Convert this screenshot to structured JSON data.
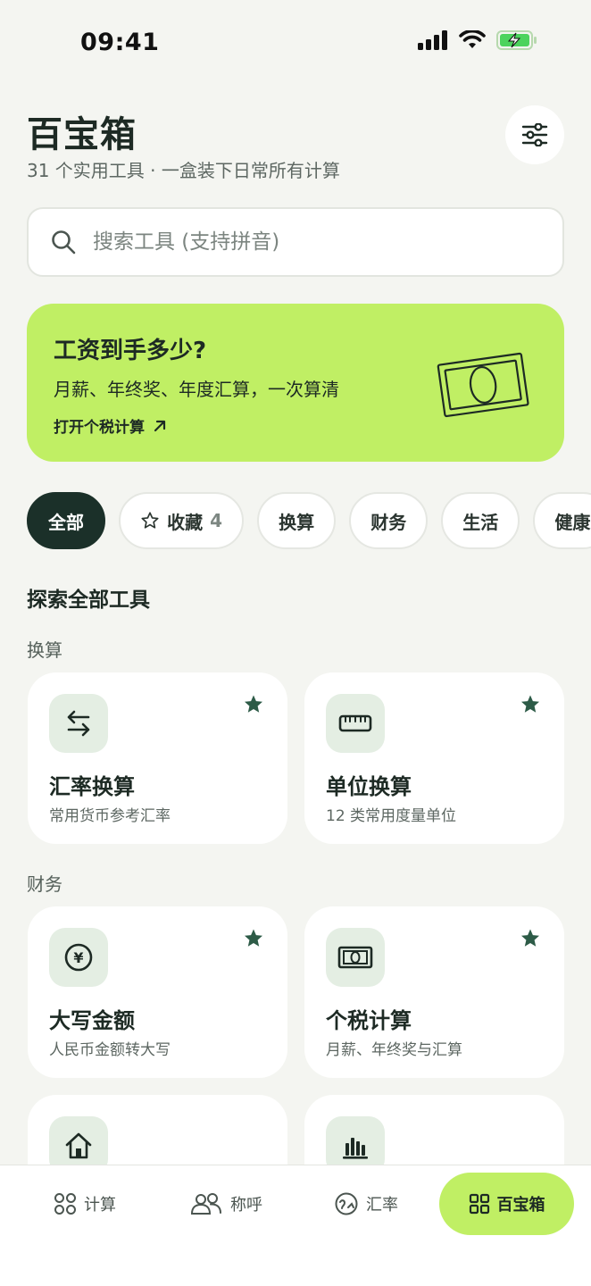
{
  "status_bar": {
    "time": "09:41"
  },
  "header": {
    "title": "百宝箱",
    "subtitle": "31 个实用工具 · 一盒装下日常所有计算"
  },
  "search": {
    "placeholder": "搜索工具 (支持拼音)",
    "value": ""
  },
  "banner": {
    "title": "工资到手多少?",
    "description": "月薪、年终奖、年度汇算，一次算清",
    "link_label": "打开个税计算",
    "link_icon": "arrow-up-right-icon",
    "background_color": "#c0ef64"
  },
  "chips": [
    {
      "label": "全部",
      "active": true
    },
    {
      "label": "收藏",
      "count": "4",
      "icon": "star-outline-icon",
      "active": false
    },
    {
      "label": "换算",
      "active": false
    },
    {
      "label": "财务",
      "active": false
    },
    {
      "label": "生活",
      "active": false
    },
    {
      "label": "健康",
      "active": false
    }
  ],
  "section_title": "探索全部工具",
  "groups": [
    {
      "label": "换算",
      "tools": [
        {
          "name": "汇率换算",
          "description": "常用货币参考汇率",
          "icon": "swap-arrows-icon",
          "favorite": true
        },
        {
          "name": "单位换算",
          "description": "12 类常用度量单位",
          "icon": "ruler-icon",
          "favorite": true
        }
      ]
    },
    {
      "label": "财务",
      "tools": [
        {
          "name": "大写金额",
          "description": "人民币金额转大写",
          "icon": "yen-coin-icon",
          "favorite": true
        },
        {
          "name": "个税计算",
          "description": "月薪、年终奖与汇算",
          "icon": "banknote-icon",
          "favorite": true
        }
      ]
    },
    {
      "label": "",
      "tools": [
        {
          "name": "",
          "description": "",
          "icon": "home-icon",
          "favorite": false
        },
        {
          "name": "",
          "description": "",
          "icon": "bar-chart-icon",
          "favorite": false
        }
      ]
    }
  ],
  "bottom_nav": [
    {
      "label": "计算",
      "icon": "grid-circles-icon",
      "active": false
    },
    {
      "label": "称呼",
      "icon": "people-icon",
      "active": false
    },
    {
      "label": "汇率",
      "icon": "globe-exchange-icon",
      "active": false
    },
    {
      "label": "百宝箱",
      "icon": "grid-squares-icon",
      "active": true
    }
  ],
  "colors": {
    "accent": "#c0ef64",
    "dark": "#1b3029",
    "icon_green": "#2d5b47",
    "background": "#f4f5f1"
  }
}
